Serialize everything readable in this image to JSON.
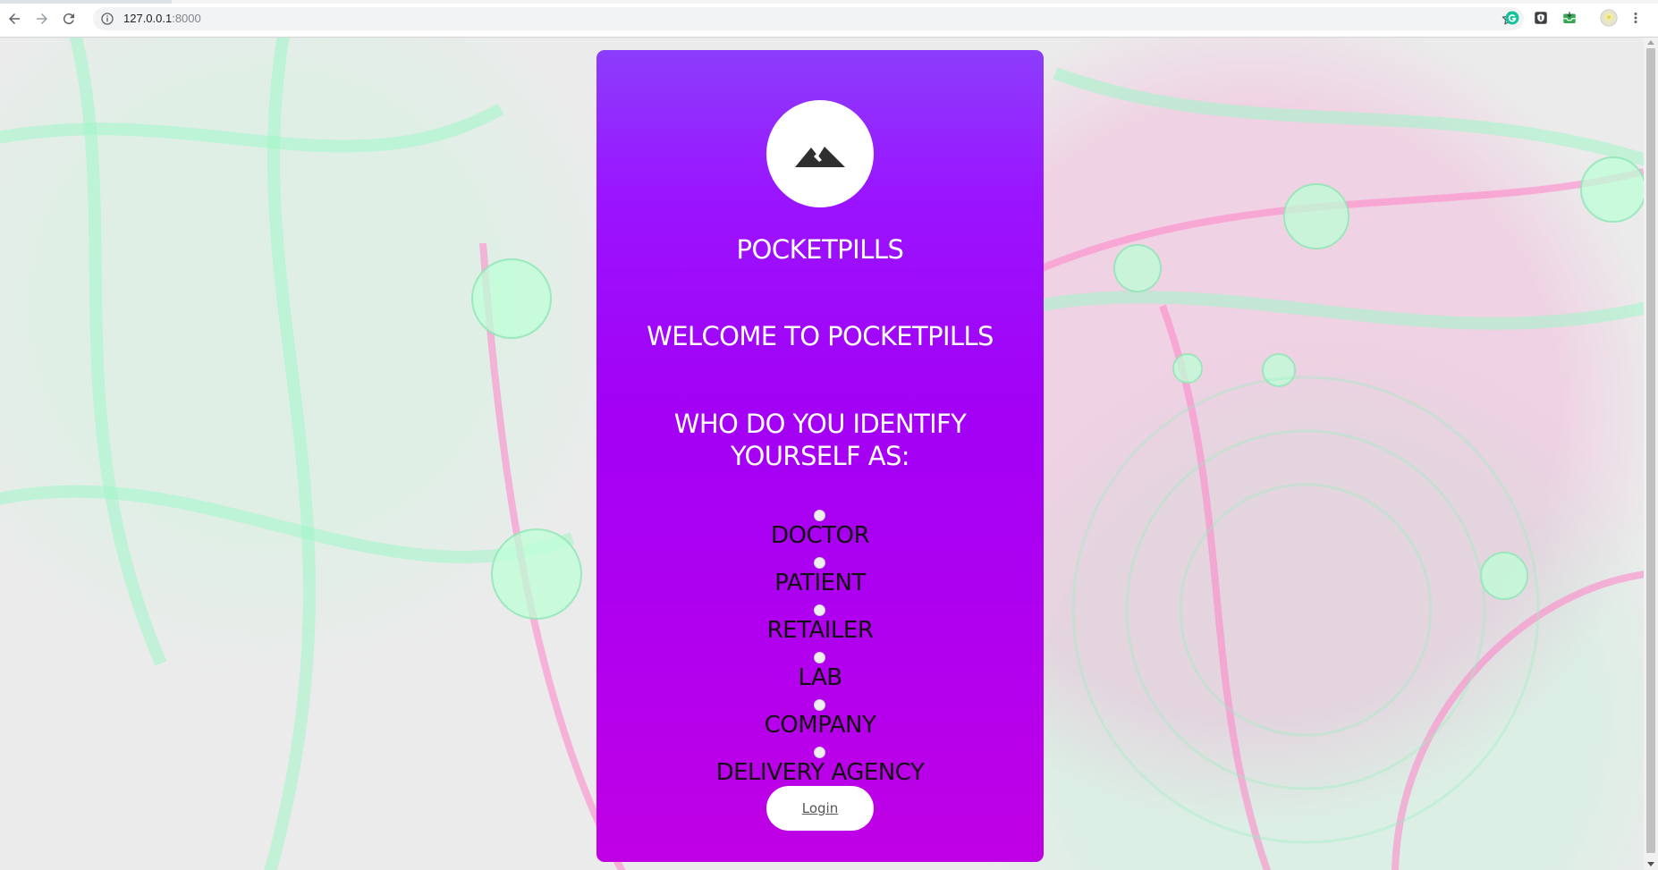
{
  "browser": {
    "url_host": "127.0.0.1",
    "url_port": ":8000",
    "icons": [
      "back-icon",
      "forward-icon",
      "reload-icon",
      "info-icon",
      "star-icon",
      "grammarly-extension-icon",
      "shield-extension-icon",
      "inbox-extension-icon",
      "profile-avatar-icon",
      "menu-icon"
    ]
  },
  "card": {
    "logo_icon": "mountain-icon",
    "brand": "POCKETPILLS",
    "welcome": "WELCOME TO POCKETPILLS",
    "question": "WHO DO YOU IDENTIFY YOURSELF AS:",
    "roles": [
      {
        "label": "DOCTOR",
        "selected": false
      },
      {
        "label": "PATIENT",
        "selected": false
      },
      {
        "label": "RETAILER",
        "selected": false
      },
      {
        "label": "LAB",
        "selected": false
      },
      {
        "label": "COMPANY",
        "selected": false
      },
      {
        "label": "DELIVERY AGENCY",
        "selected": false
      }
    ],
    "login_label": "Login"
  },
  "colors": {
    "card_gradient_top": "#8c3dfb",
    "card_gradient_bottom": "#c000e4",
    "page_background": "#ebebeb",
    "accent_pink": "#ff78c8",
    "accent_green": "#96ffc8"
  }
}
